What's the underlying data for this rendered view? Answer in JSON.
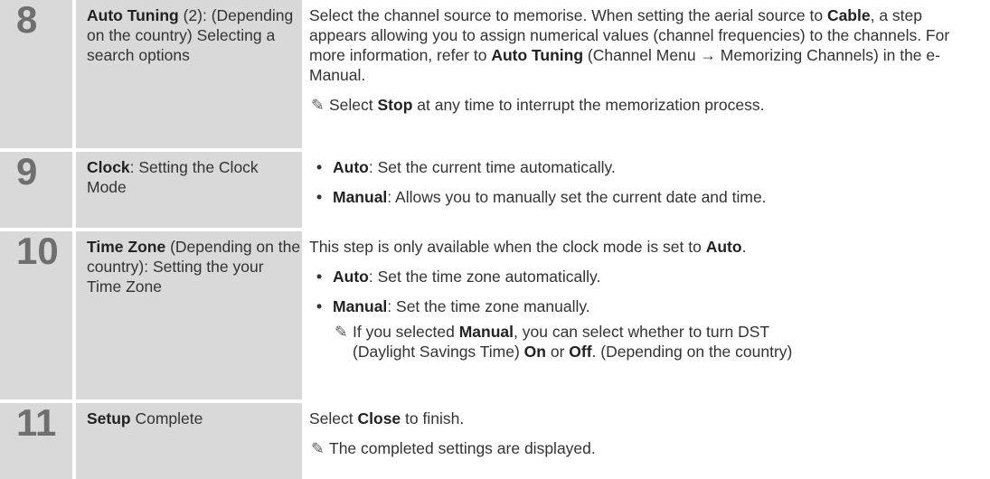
{
  "rows": [
    {
      "number": "8",
      "title_bold": "Auto Tuning",
      "title_rest": " (2): (Depending on the country) Selecting a search options",
      "desc_line1_a": "Select the channel source to memorise. When setting the aerial source to ",
      "desc_line1_bold1": "Cable",
      "desc_line1_b": ", a step appears allowing you to assign numerical values (channel frequencies) to the channels. For more information, refer to ",
      "desc_line1_bold2": "Auto Tuning",
      "desc_line1_c": " (Channel Menu → Memorizing Channels) in the e-Manual.",
      "note_a": "Select ",
      "note_bold": "Stop",
      "note_b": " at any time to interrupt the memorization process."
    },
    {
      "number": "9",
      "title_bold": "Clock",
      "title_rest": ": Setting the Clock Mode",
      "bullets": [
        {
          "bold": "Auto",
          "text": ": Set the current time automatically."
        },
        {
          "bold": "Manual",
          "text": ": Allows you to manually set the current date and time."
        }
      ]
    },
    {
      "number": "10",
      "title_bold": "Time Zone",
      "title_rest": " (Depending on the country): Setting the your Time Zone",
      "intro_a": "This step is only available when the clock mode is set to ",
      "intro_bold": "Auto",
      "intro_b": ".",
      "bullets": [
        {
          "bold": "Auto",
          "text": ": Set the time zone automatically."
        },
        {
          "bold": "Manual",
          "text": ": Set the time zone manually."
        }
      ],
      "subnote_a": "If you selected ",
      "subnote_bold1": "Manual",
      "subnote_b": ", you can select whether to turn DST",
      "subnote_c": "(Daylight Savings Time) ",
      "subnote_bold2": "On",
      "subnote_d": " or ",
      "subnote_bold3": "Off",
      "subnote_e": ". (Depending on the country)"
    },
    {
      "number": "11",
      "title_bold": "Setup",
      "title_rest": " Complete",
      "intro_a": "Select ",
      "intro_bold": "Close",
      "intro_b": " to finish.",
      "note_text": "The completed settings are displayed."
    }
  ],
  "icons": {
    "note": "pencil-note-icon",
    "glyph": "✎"
  }
}
